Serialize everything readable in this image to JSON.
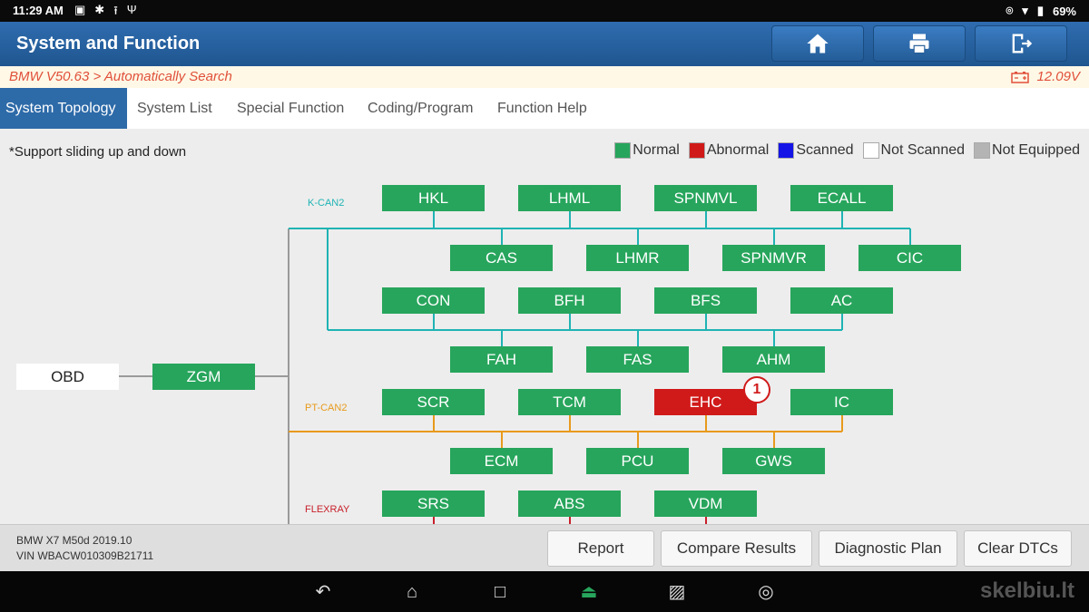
{
  "status_bar": {
    "time": "11:29 AM",
    "battery": "69%"
  },
  "header": {
    "title": "System and Function"
  },
  "path_bar": {
    "path": "BMW V50.63 > Automatically Search",
    "voltage": "12.09V"
  },
  "tabs": [
    {
      "label": "System Topology",
      "active": true
    },
    {
      "label": "System List"
    },
    {
      "label": "Special Function"
    },
    {
      "label": "Coding/Program"
    },
    {
      "label": "Function Help"
    }
  ],
  "topology": {
    "hint": "*Support sliding up and down",
    "legend": [
      {
        "label": "Normal",
        "color": "#27a55c"
      },
      {
        "label": "Abnormal",
        "color": "#d01a1a"
      },
      {
        "label": "Scanned",
        "color": "#1414e6"
      },
      {
        "label": "Not Scanned",
        "color": "#ffffff"
      },
      {
        "label": "Not Equipped",
        "color": "#b4b4b4"
      }
    ],
    "root": "OBD",
    "gateway": "ZGM",
    "buses": [
      {
        "name": "K-CAN2",
        "color": "#1fb3b3"
      },
      {
        "name": "PT-CAN2",
        "color": "#e89a1c"
      },
      {
        "name": "FLEXRAY",
        "color": "#c8202a"
      }
    ],
    "modules": {
      "hkl": "HKL",
      "lhml": "LHML",
      "spnmvl": "SPNMVL",
      "ecall": "ECALL",
      "cas": "CAS",
      "lhmr": "LHMR",
      "spnmvr": "SPNMVR",
      "cic": "CIC",
      "con": "CON",
      "bfh": "BFH",
      "bfs": "BFS",
      "ac": "AC",
      "fah": "FAH",
      "fas": "FAS",
      "ahm": "AHM",
      "scr": "SCR",
      "tcm": "TCM",
      "ehc": "EHC",
      "ic": "IC",
      "ecm": "ECM",
      "pcu": "PCU",
      "gws": "GWS",
      "srs": "SRS",
      "abs": "ABS",
      "vdm": "VDM"
    },
    "ehc_fault_count": "1"
  },
  "footer": {
    "vehicle": "BMW X7 M50d 2019.10",
    "vin": "VIN WBACW010309B21711",
    "buttons": {
      "report": "Report",
      "compare": "Compare Results",
      "plan": "Diagnostic Plan",
      "clear": "Clear DTCs"
    }
  },
  "watermark": "skelbiu.lt"
}
